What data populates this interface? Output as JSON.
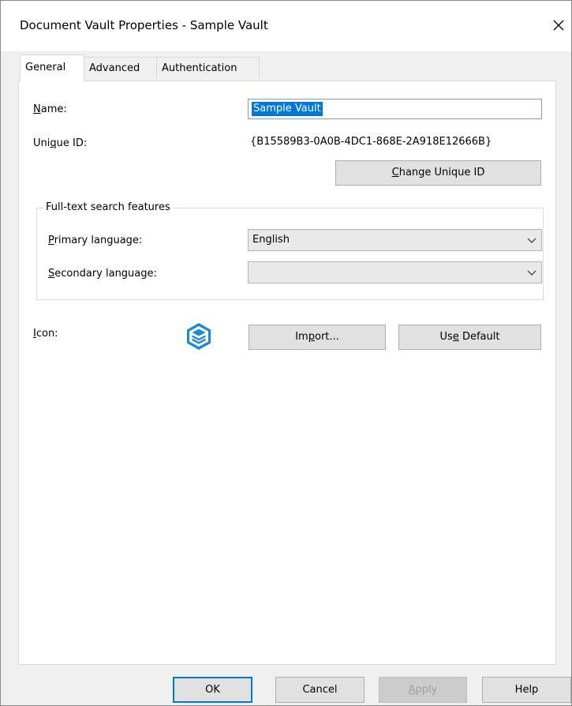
{
  "window": {
    "title": "Document Vault Properties - Sample Vault",
    "close_icon": "close-icon"
  },
  "tabs": [
    {
      "label": "General",
      "active": true
    },
    {
      "label": "Advanced",
      "active": false
    },
    {
      "label": "Authentication",
      "active": false
    }
  ],
  "general": {
    "name_label": "Name:",
    "name_value": "Sample Vault",
    "unique_id_label": "Unique ID:",
    "unique_id_value": "{B15589B3-0A0B-4DC1-868E-2A918E12666B}",
    "change_unique_id_button": "Change Unique ID",
    "fulltext_group": {
      "title": "Full-text search features",
      "primary_label": "Primary language:",
      "primary_value": "English",
      "secondary_label": "Secondary language:",
      "secondary_value": ""
    },
    "icon_label": "Icon:",
    "icon_name": "vault-layers-icon",
    "import_button": "Import...",
    "use_default_button": "Use Default"
  },
  "footer": {
    "ok": "OK",
    "cancel": "Cancel",
    "apply": "Apply",
    "help": "Help"
  },
  "colors": {
    "accent": "#0078d7",
    "vault_icon": "#1a8ad4"
  }
}
